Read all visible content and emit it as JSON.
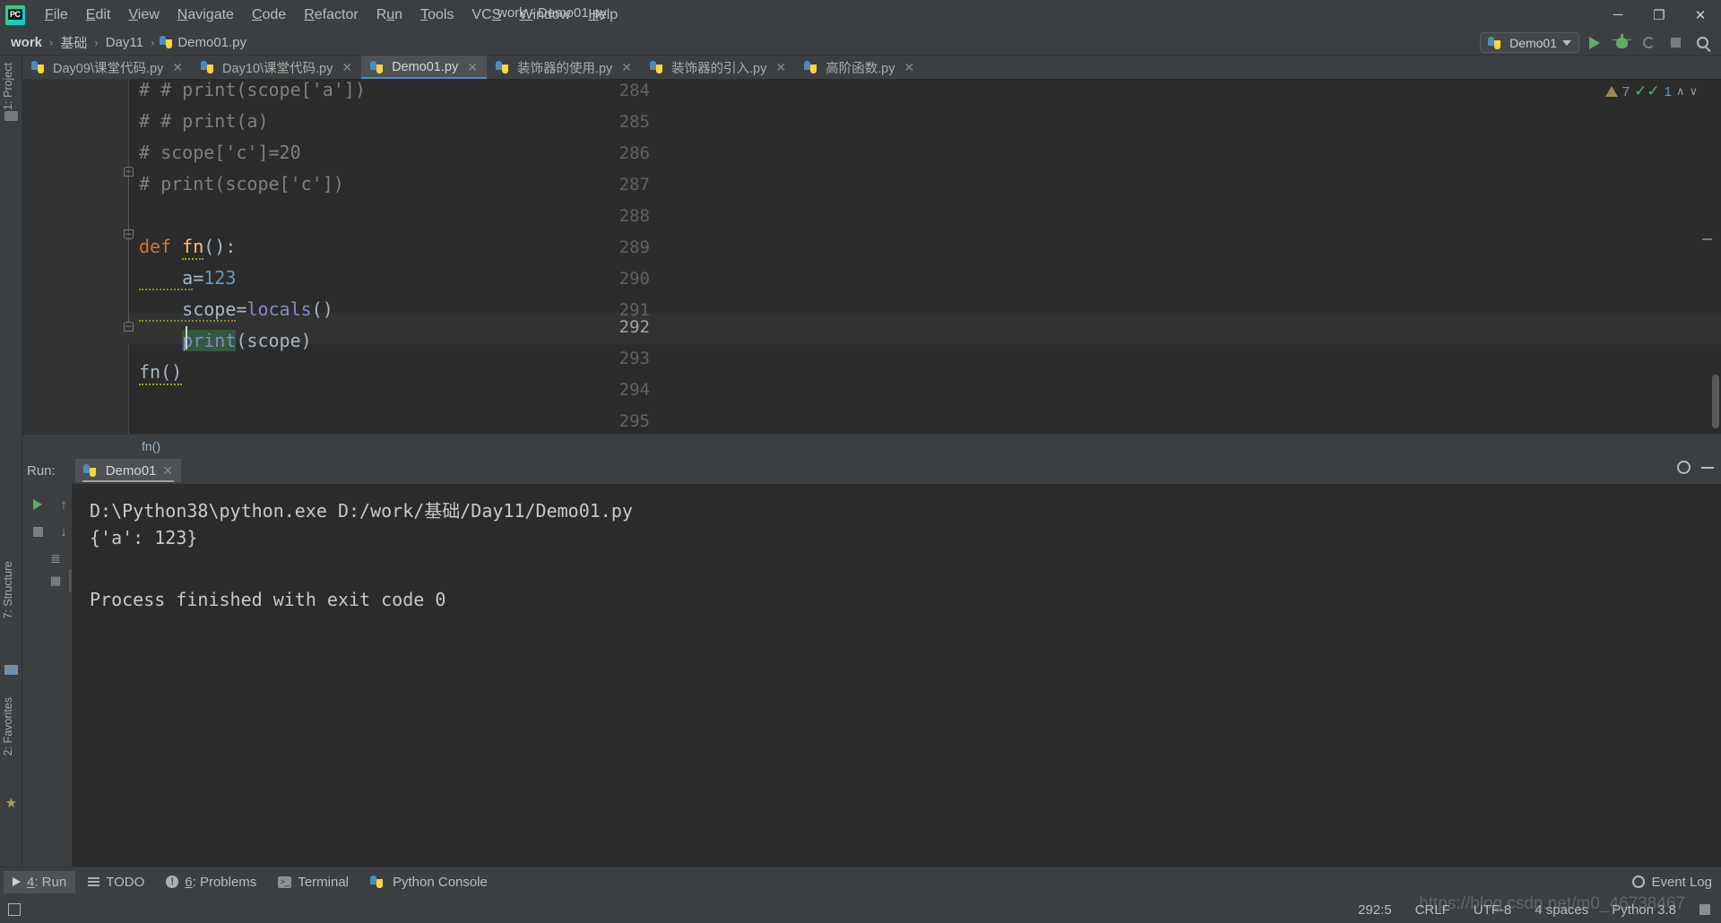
{
  "window": {
    "title": "work - Demo01.py",
    "app_icon": "pycharm-logo",
    "minimize": "─",
    "maximize": "❐",
    "close": "✕"
  },
  "menu": {
    "items": [
      {
        "label": "File",
        "mnemonic": "F"
      },
      {
        "label": "Edit",
        "mnemonic": "E"
      },
      {
        "label": "View",
        "mnemonic": "V"
      },
      {
        "label": "Navigate",
        "mnemonic": "N"
      },
      {
        "label": "Code",
        "mnemonic": "C"
      },
      {
        "label": "Refactor",
        "mnemonic": "R"
      },
      {
        "label": "Run",
        "mnemonic": "u"
      },
      {
        "label": "Tools",
        "mnemonic": "T"
      },
      {
        "label": "VCS",
        "mnemonic": "S"
      },
      {
        "label": "Window",
        "mnemonic": "W"
      },
      {
        "label": "Help",
        "mnemonic": "H"
      }
    ]
  },
  "breadcrumb": {
    "items": [
      "work",
      "基础",
      "Day11",
      "Demo01.py"
    ],
    "separator": "›"
  },
  "toolbar": {
    "run_config": "Demo01",
    "run": "run-icon",
    "debug": "debug-icon",
    "coverage": "coverage-icon",
    "stop": "stop-icon",
    "search": "search-icon"
  },
  "tabs": [
    {
      "label": "Day09\\课堂代码.py",
      "active": false
    },
    {
      "label": "Day10\\课堂代码.py",
      "active": false
    },
    {
      "label": "Demo01.py",
      "active": true
    },
    {
      "label": "装饰器的使用.py",
      "active": false
    },
    {
      "label": "装饰器的引入.py",
      "active": false
    },
    {
      "label": "高阶函数.py",
      "active": false
    }
  ],
  "left_strip": {
    "project": "1: Project",
    "structure": "7: Structure",
    "favorites": "2: Favorites"
  },
  "editor": {
    "first_line_number": 284,
    "lines": [
      {
        "n": "284",
        "text": "# # print(scope['a'])"
      },
      {
        "n": "285",
        "text": "# # print(a)"
      },
      {
        "n": "286",
        "text": "# scope['c']=20"
      },
      {
        "n": "287",
        "text": "# print(scope['c'])"
      },
      {
        "n": "288",
        "text": ""
      },
      {
        "n": "289",
        "text": "def fn():"
      },
      {
        "n": "290",
        "text": "    a=123"
      },
      {
        "n": "291",
        "text": "    scope=locals()"
      },
      {
        "n": "292",
        "text": "    print(scope)"
      },
      {
        "n": "293",
        "text": "fn()"
      },
      {
        "n": "294",
        "text": ""
      },
      {
        "n": "295",
        "text": ""
      }
    ],
    "current_line": "292",
    "breadcrumb": "fn()",
    "inspections": {
      "warning_count": "7",
      "ok_count": "1",
      "prev": "∧",
      "next": "∨"
    }
  },
  "run_window": {
    "label": "Run:",
    "tab": "Demo01",
    "close": "✕",
    "settings": "gear-icon",
    "hide": "minimize-icon",
    "console_lines": [
      "D:\\Python38\\python.exe D:/work/基础/Day11/Demo01.py",
      "{'a': 123}",
      "",
      "Process finished with exit code 0"
    ],
    "side_buttons": [
      "rerun-icon",
      "scroll-up-icon",
      "stop-icon",
      "scroll-down-icon",
      "print-layout-icon",
      "soft-wrap-icon",
      "scroll-to-end-icon",
      "print-icon",
      "clear-all-icon"
    ]
  },
  "bottom_bar": {
    "items": [
      {
        "label": "4: Run",
        "mnemonic": "4",
        "icon": "run-icon",
        "active": true
      },
      {
        "label": "TODO",
        "mnemonic": "",
        "icon": "todo-icon",
        "active": false
      },
      {
        "label": "6: Problems",
        "mnemonic": "6",
        "icon": "problems-icon",
        "active": false
      },
      {
        "label": "Terminal",
        "mnemonic": "",
        "icon": "terminal-icon",
        "active": false
      },
      {
        "label": "Python Console",
        "mnemonic": "",
        "icon": "python-icon",
        "active": false
      }
    ],
    "event_log": "Event Log"
  },
  "status_bar": {
    "caret_position": "292:5",
    "line_separator": "CRLF",
    "encoding": "UTF-8",
    "indent": "4 spaces",
    "interpreter": "Python 3.8",
    "lock": "read-only-lock-icon"
  },
  "watermark": "https://blog.csdn.net/m0_46738467",
  "colors": {
    "chrome_bg": "#3c3f41",
    "editor_bg": "#2b2b2b",
    "gutter_bg": "#313335",
    "tab_active": "#4e5254",
    "tab_underline": "#4a88c7",
    "keyword": "#cc7832",
    "function": "#ffc66d",
    "number": "#6897bb",
    "builtin": "#8888c6",
    "comment": "#808080",
    "plain": "#a9b7c6",
    "identifier_highlight": "#32593d",
    "run_green": "#5fad65"
  }
}
